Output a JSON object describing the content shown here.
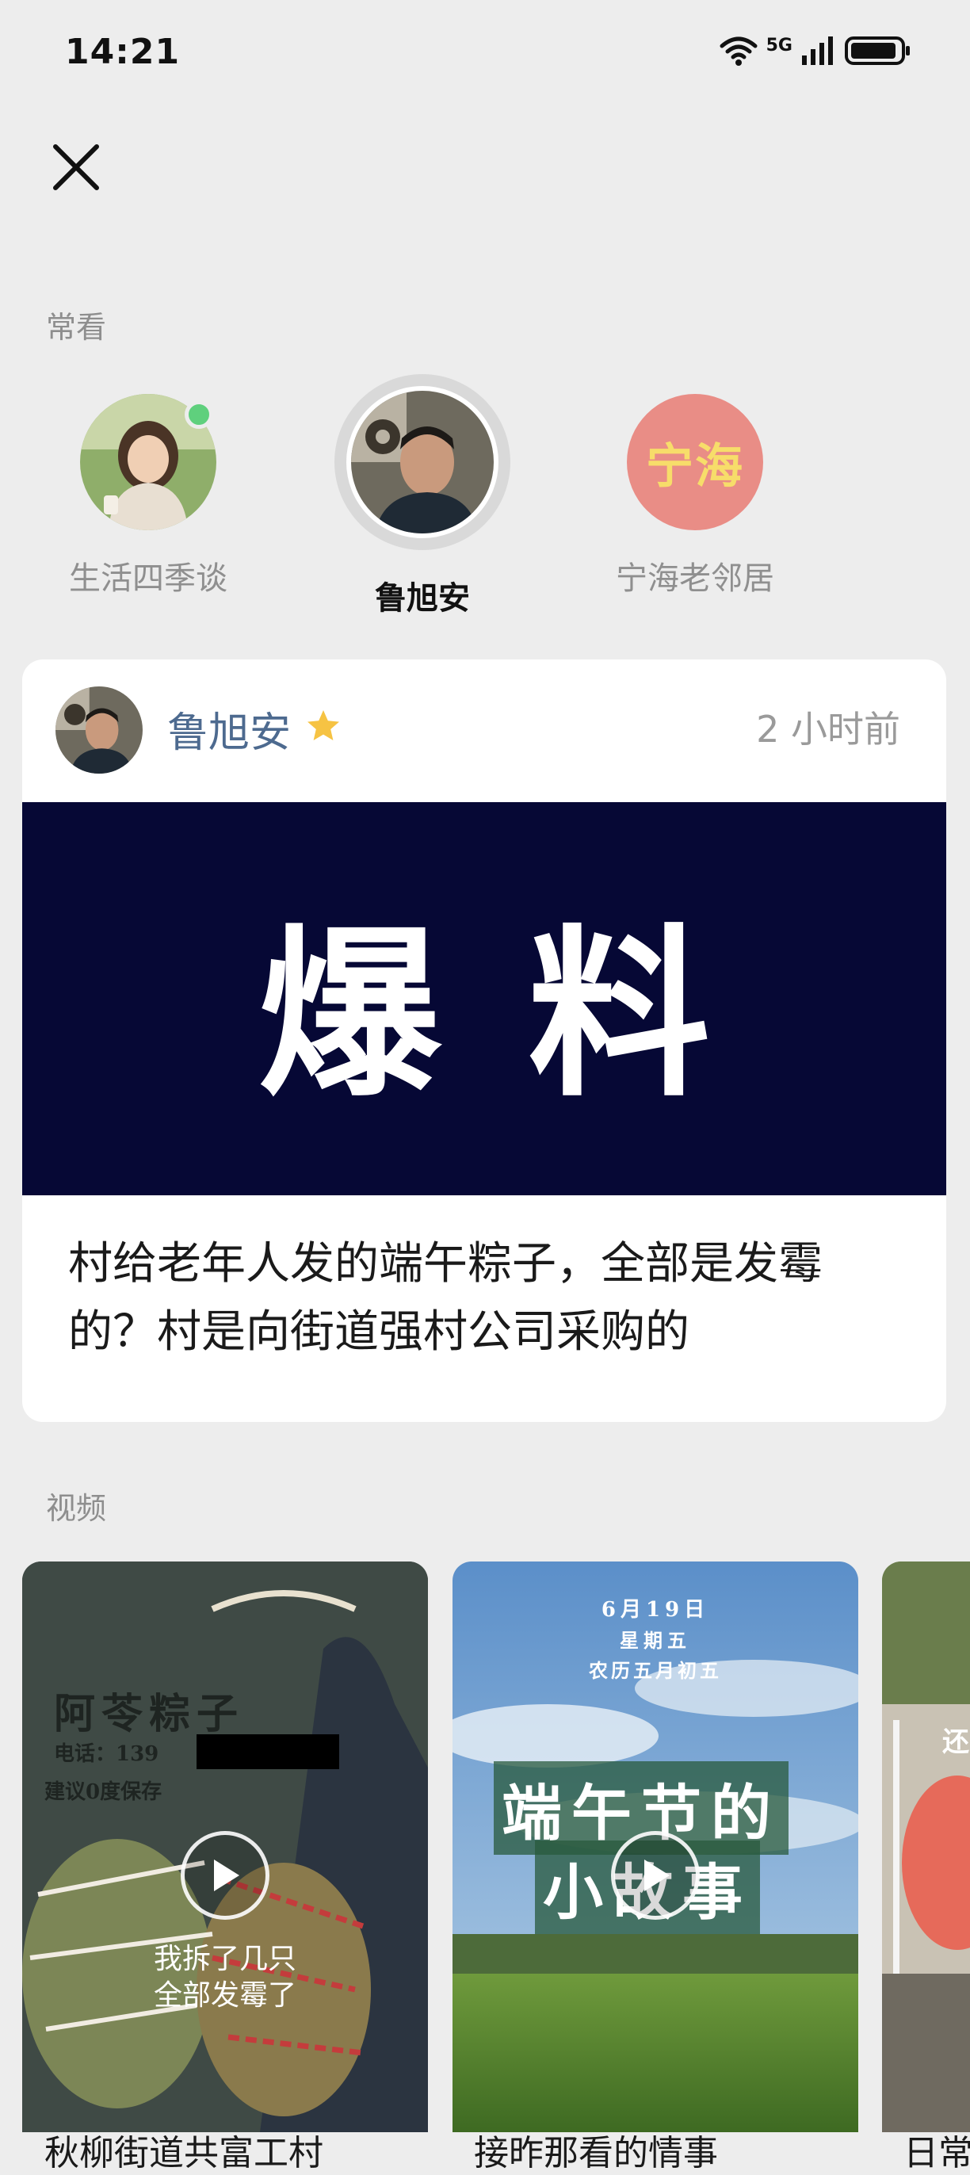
{
  "status_bar": {
    "time": "14:21",
    "network": "5G"
  },
  "frequent": {
    "label": "常看",
    "items": [
      {
        "name": "生活四季谈",
        "online": true
      },
      {
        "name": "鲁旭安",
        "selected": true
      },
      {
        "name": "宁海老邻居",
        "avatar_text": "宁海"
      }
    ]
  },
  "card": {
    "author": "鲁旭安",
    "time": "2 小时前",
    "banner_text": "爆料",
    "title": "村给老年人发的端午粽子，全部是发霉的？村是向街道强村公司采购的"
  },
  "videos": {
    "label": "视频",
    "items": [
      {
        "overlay_brand": "阿苓粽子",
        "overlay_phone": "电话：139",
        "overlay_note": "建议0度保存",
        "caption_line1": "我拆了几只",
        "caption_line2": "全部发霉了",
        "title_peek": "秋柳街道共富工村"
      },
      {
        "date_line1": "6月19日",
        "date_line2": "星期五",
        "date_line3": "农历五月初五",
        "headline_line1": "端午节的",
        "headline_line2": "小故事",
        "title_peek": "接昨那看的情事"
      },
      {
        "overlay_text": "还",
        "title_peek": "日常"
      }
    ]
  },
  "colors": {
    "background": "#ededed",
    "author": "#4d6a8f",
    "banner": "#060835",
    "star": "#f6c343",
    "online": "#5fd07d"
  }
}
